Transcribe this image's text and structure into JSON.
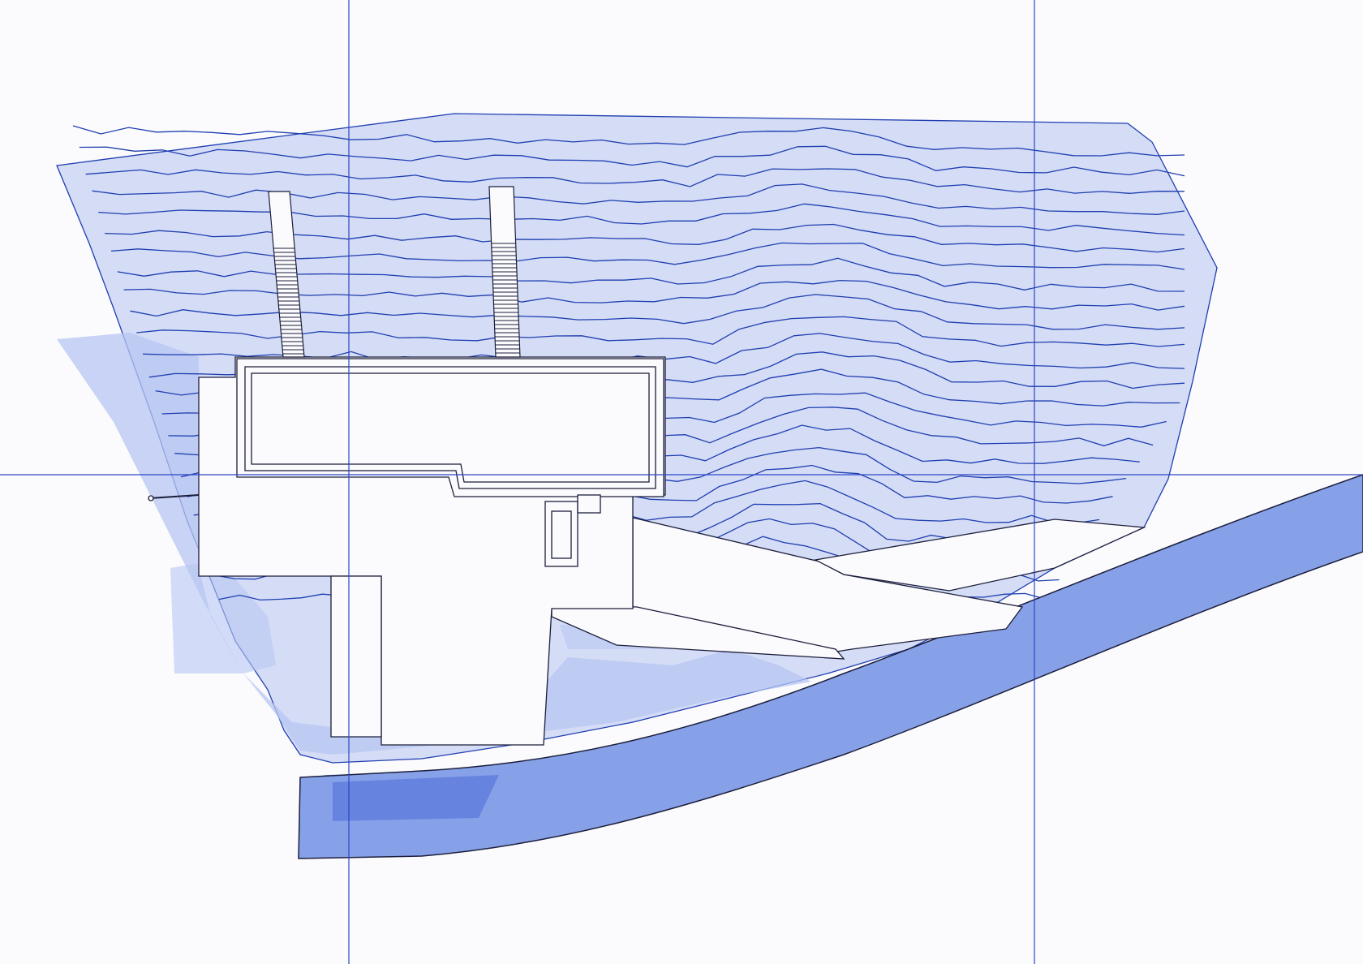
{
  "drawing": {
    "colors": {
      "background": "#fbfbfe",
      "terrain_fill": "#d4dcf6",
      "contour_line": "#1f3eb0",
      "shadow": "#b7c6f2",
      "shadow_dark": "#9fb2ec",
      "road_fill": "#87a1e8",
      "road_dark": "#6684df",
      "building_fill": "#fbfafd",
      "building_stroke": "#1b1e3a",
      "guide_line": "#2c45c6"
    },
    "layers": [
      "terrain",
      "contours",
      "shadows",
      "road",
      "building",
      "stairs",
      "guides"
    ]
  }
}
